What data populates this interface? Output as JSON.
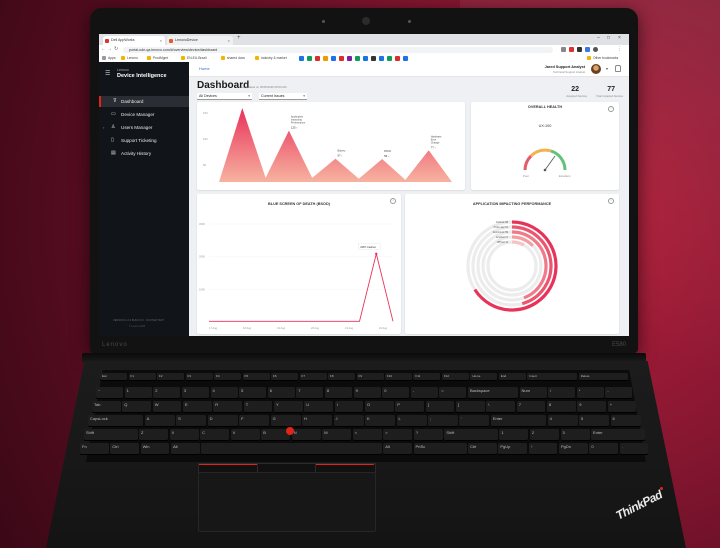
{
  "browser": {
    "tabs": [
      "Dell AppWorks",
      "LenovoDevice"
    ],
    "url": "portal-ude-qa.lenovo.com/#/overview/device/dashboard",
    "bookmarks": [
      "Apps",
      "Lenovo",
      "ProdMgmt",
      "EN-EU-Brazil",
      "shared docs",
      "industry & market",
      "Other bookmarks"
    ]
  },
  "app": {
    "brand_line1": "Lenovo",
    "brand_line2": "Device Intelligence",
    "nav": [
      {
        "label": "Dashboard",
        "icon": "filter-icon",
        "active": true
      },
      {
        "label": "Device Manager",
        "icon": "monitor-icon",
        "active": false
      },
      {
        "label": "Users Manager",
        "icon": "user-icon",
        "active": false
      },
      {
        "label": "Support Ticketing",
        "icon": "ticket-icon",
        "active": false
      },
      {
        "label": "Activity History",
        "icon": "history-icon",
        "active": false
      }
    ],
    "sidebar_footer": "VERSION 1.2.0 BUILD XX · FOOTER TEXT",
    "sidebar_footer2": "© Lenovo 2020"
  },
  "header": {
    "breadcrumb": "Home",
    "user_name": "Jared Support Analyst",
    "user_role": "Technical Support Analyst"
  },
  "dashboard": {
    "title": "Dashboard",
    "updated": "Last updated on 05/05/2020 08:00 AM",
    "filter_device": "All Devices",
    "filter_period": "Current Issues",
    "stats": [
      {
        "value": "22",
        "label": "Assigned Devices"
      },
      {
        "value": "77",
        "label": "Total Impacted Devices"
      }
    ]
  },
  "cards": {
    "overall_health_title": "OVERALL HEALTH",
    "overall_health_value": "UX:100",
    "gauge_low": "Poor",
    "gauge_high": "Excellent",
    "bsod_title": "BLUE SCREEN OF DEATH (BSOD)",
    "bsod_tooltip": "2087 crashes",
    "app_perf_title": "APPLICATION IMPACTING PERFORMANCE",
    "app_legend": [
      "Outlook 88",
      "Proto app 61",
      "Zoom/msk 59",
      "Acrobat 17",
      "JPHost 11"
    ]
  },
  "chart_data": [
    {
      "type": "area",
      "title": "",
      "annotations": [
        "Application Impacting Performance",
        "Battery",
        "BSOD",
        "Hardware Error Change"
      ],
      "annotation_values": [
        "125",
        "57",
        "56",
        "77"
      ],
      "y_ticks": [
        "150",
        "100",
        "50"
      ],
      "x": [
        0,
        1,
        2,
        3,
        4,
        5,
        6,
        7
      ],
      "values": [
        0,
        180,
        10,
        125,
        10,
        57,
        8,
        56,
        5,
        77,
        0
      ]
    },
    {
      "type": "line",
      "title": "BLUE SCREEN OF DEATH (BSOD)",
      "y_ticks": [
        "3000",
        "2000",
        "1000"
      ],
      "x_ticks": [
        "17 Aug",
        "18 Aug",
        "19 Aug",
        "20 Aug",
        "21 Aug",
        "22 Aug"
      ],
      "values": [
        20,
        20,
        20,
        20,
        20,
        20,
        20,
        20,
        20,
        20,
        2087,
        20
      ]
    },
    {
      "type": "radial-bar",
      "title": "APPLICATION IMPACTING PERFORMANCE",
      "categories": [
        "Outlook",
        "Proto app",
        "Zoom/msk",
        "Acrobat",
        "JPHost"
      ],
      "values": [
        88,
        61,
        59,
        17,
        11
      ]
    }
  ],
  "keyboard": {
    "row1": [
      "Esc",
      "F1",
      "F2",
      "F3",
      "F4",
      "F5",
      "F6",
      "F7",
      "F8",
      "F9",
      "F10",
      "F11",
      "F12",
      "Home",
      "End",
      "Insert",
      "Delete"
    ],
    "row2": [
      "~",
      "1",
      "2",
      "3",
      "4",
      "5",
      "6",
      "7",
      "8",
      "9",
      "0",
      "-",
      "=",
      "Backspace",
      "Num",
      "/",
      "*",
      "-"
    ],
    "row3": [
      "Tab",
      "Q",
      "W",
      "E",
      "R",
      "T",
      "Y",
      "U",
      "I",
      "O",
      "P",
      "[",
      "]",
      "\\",
      "7",
      "8",
      "9",
      "+"
    ],
    "row4": [
      "CapsLock",
      "A",
      "S",
      "D",
      "F",
      "G",
      "H",
      "J",
      "K",
      "L",
      ";",
      "'",
      "Enter",
      "4",
      "5",
      "6"
    ],
    "row5": [
      "Shift",
      "Z",
      "X",
      "C",
      "V",
      "B",
      "N",
      "M",
      "<",
      ">",
      "?",
      "Shift",
      "1",
      "2",
      "3",
      "Enter"
    ],
    "row6": [
      "Fn",
      "Ctrl",
      "Win",
      "Alt",
      "",
      "Alt",
      "PrtSc",
      "Ctrl",
      "PgUp",
      "↑",
      "PgDn",
      "0",
      "."
    ],
    "brand_lid": "Lenovo",
    "model": "E580",
    "thinkpad": "ThinkPad"
  }
}
